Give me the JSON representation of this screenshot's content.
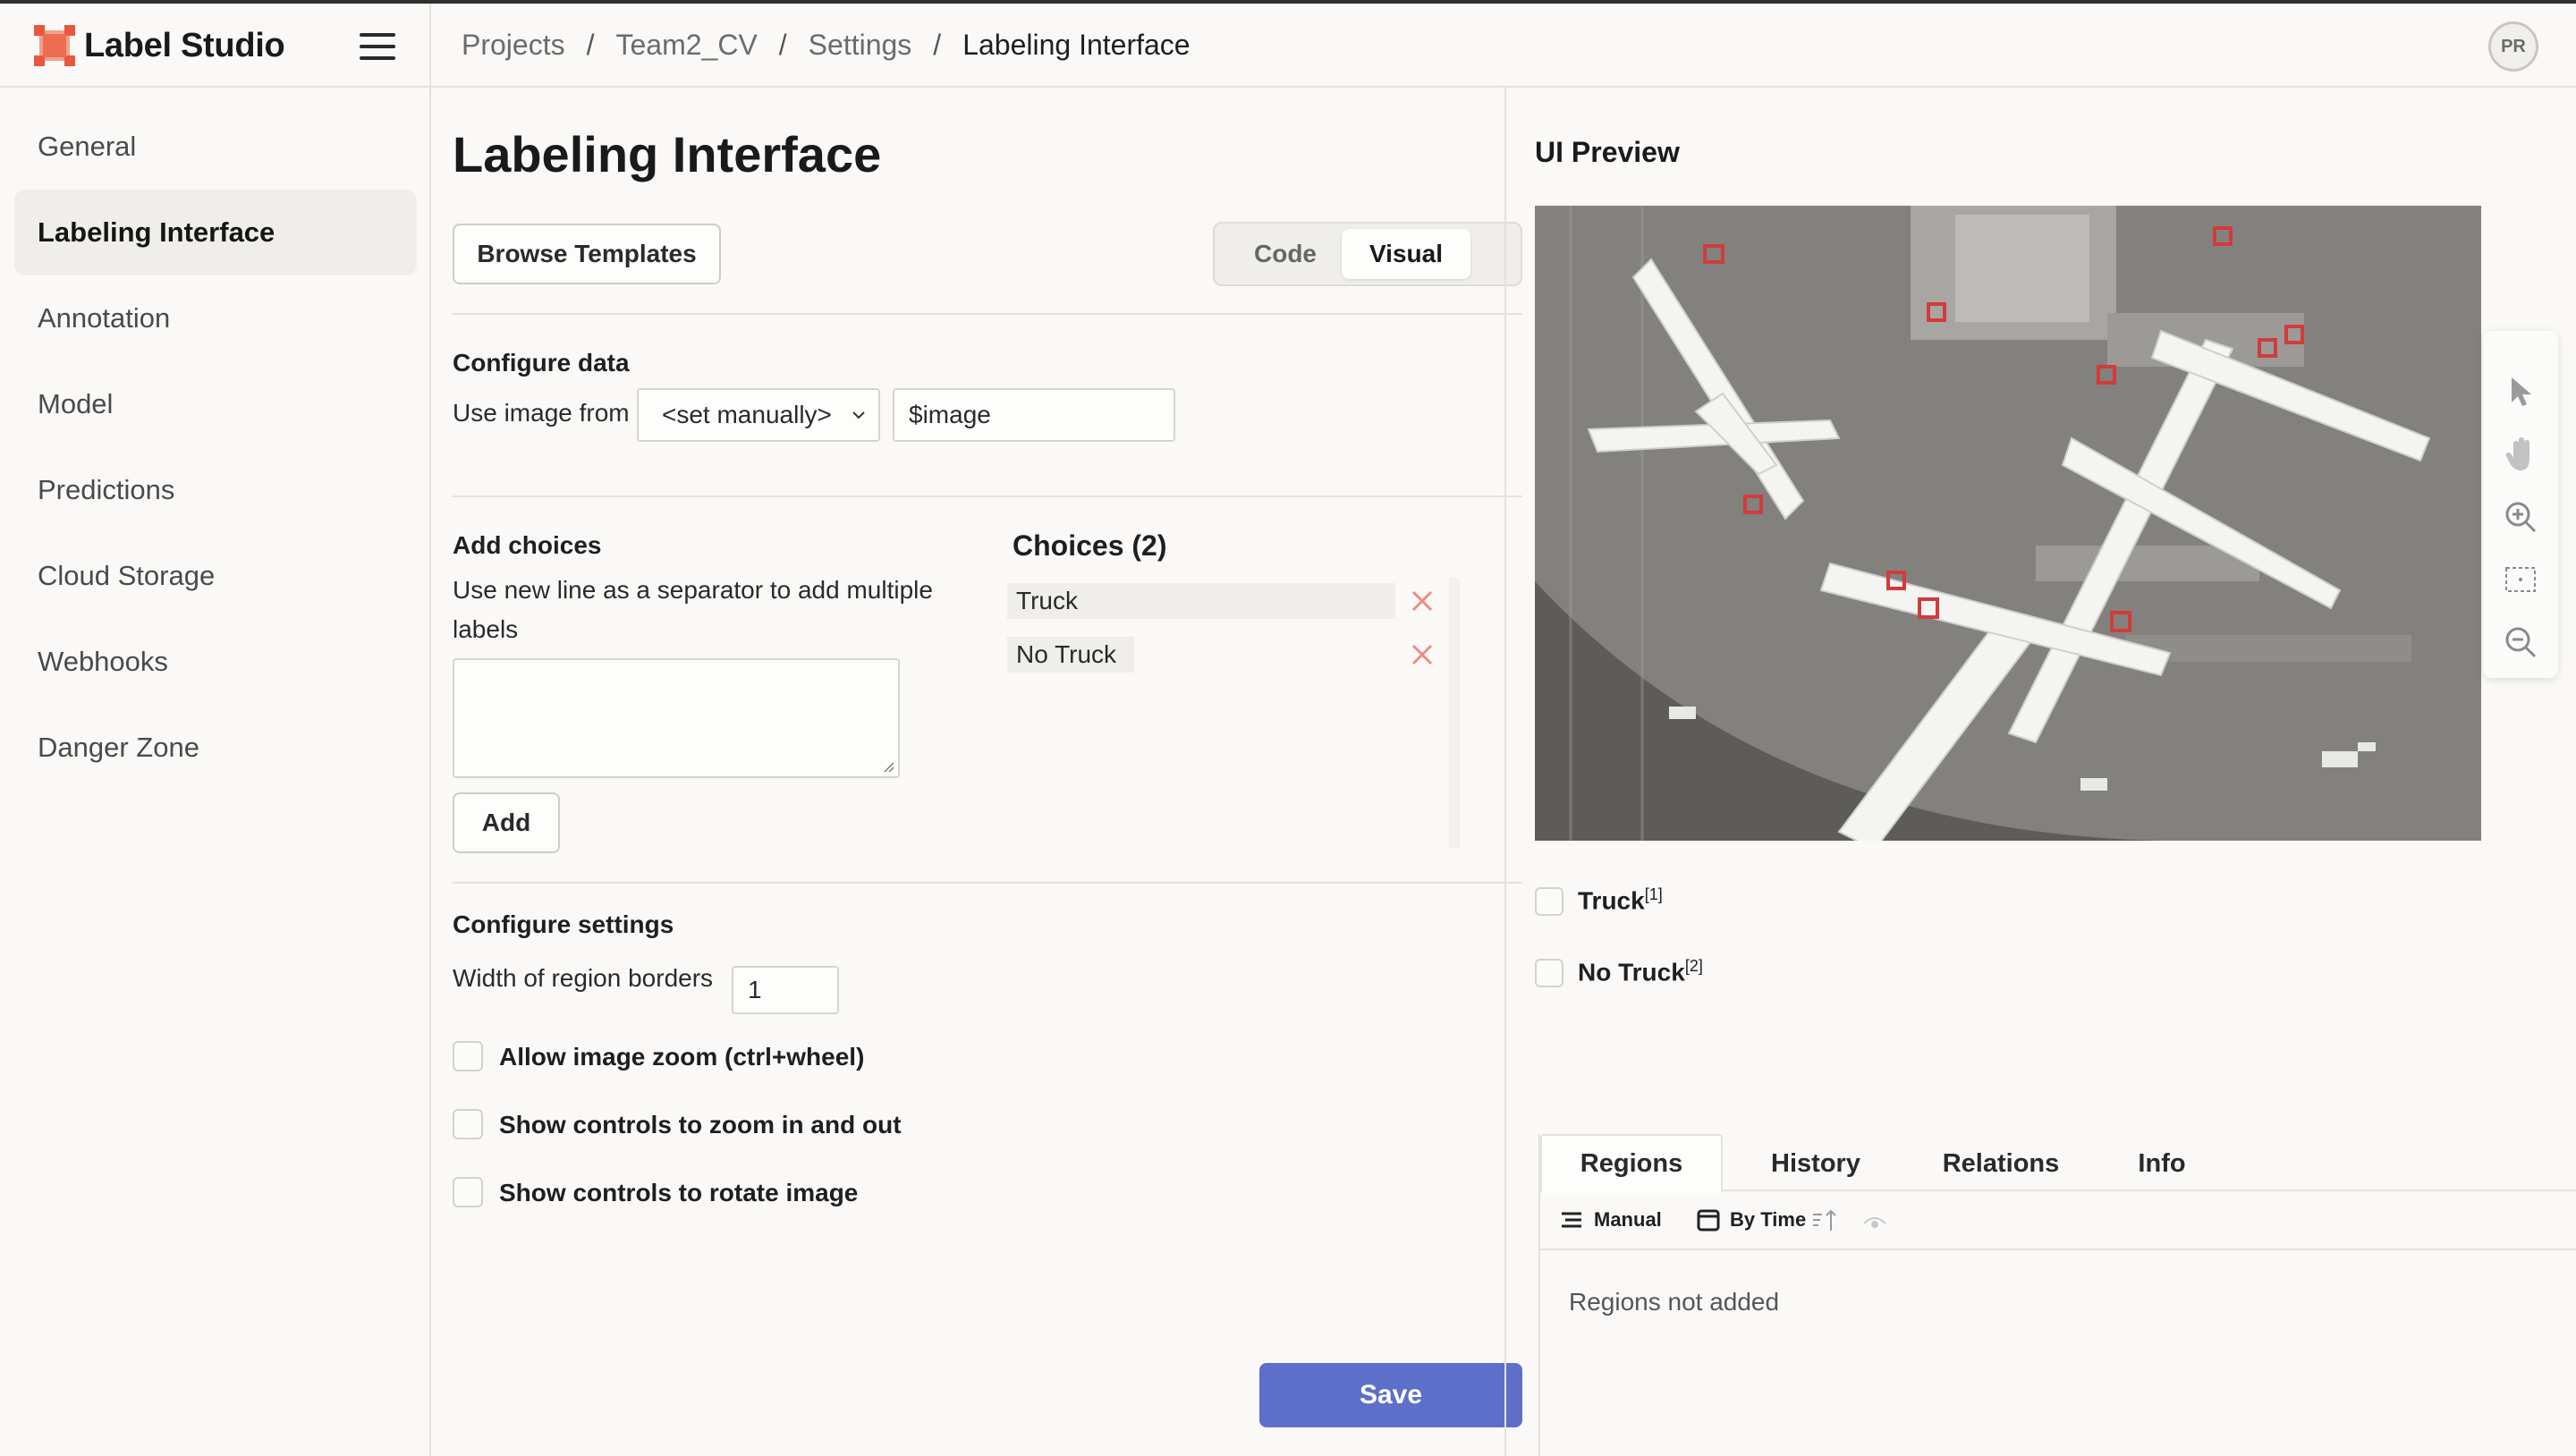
{
  "app": {
    "title": "Label Studio"
  },
  "breadcrumb": {
    "items": [
      "Projects",
      "Team2_CV",
      "Settings",
      "Labeling Interface"
    ],
    "separator": "/"
  },
  "user": {
    "initials": "PR"
  },
  "sidebar": {
    "items": [
      {
        "label": "General"
      },
      {
        "label": "Labeling Interface",
        "active": true
      },
      {
        "label": "Annotation"
      },
      {
        "label": "Model"
      },
      {
        "label": "Predictions"
      },
      {
        "label": "Cloud Storage"
      },
      {
        "label": "Webhooks"
      },
      {
        "label": "Danger Zone"
      }
    ]
  },
  "main": {
    "title": "Labeling Interface",
    "browse_templates": "Browse Templates",
    "mode_tabs": {
      "code": "Code",
      "visual": "Visual",
      "active": "Visual"
    },
    "configure_data": {
      "title": "Configure data",
      "use_image_label": "Use image from",
      "select_value": "<set manually>",
      "input_value": "$image"
    },
    "add_choices": {
      "title": "Add choices",
      "help": "Use new line as a separator to add multiple labels",
      "textarea_value": "",
      "add_label": "Add"
    },
    "choices": {
      "title": "Choices (2)",
      "items": [
        "Truck",
        "No Truck"
      ]
    },
    "configure_settings": {
      "title": "Configure settings",
      "border_width_label": "Width of region borders",
      "border_width_value": "1",
      "options": [
        {
          "label": "Allow image zoom (ctrl+wheel)",
          "checked": false
        },
        {
          "label": "Show controls to zoom in and out",
          "checked": false
        },
        {
          "label": "Show controls to rotate image",
          "checked": false
        }
      ]
    },
    "save_label": "Save"
  },
  "preview": {
    "title": "UI Preview",
    "choices": [
      {
        "label": "Truck",
        "hotkey": "[1]",
        "checked": false
      },
      {
        "label": "No Truck",
        "hotkey": "[2]",
        "checked": false
      }
    ],
    "tabs": [
      "Regions",
      "History",
      "Relations",
      "Info"
    ],
    "active_tab": "Regions",
    "sort": {
      "manual": "Manual",
      "by_time": "By Time"
    },
    "empty_text": "Regions not added"
  },
  "icons": {
    "toolbar": [
      "pointer-icon",
      "hand-icon",
      "zoom-in-icon",
      "fit-screen-icon",
      "zoom-out-icon"
    ]
  },
  "colors": {
    "accent": "#5e6fc9",
    "logo": "#e8583d",
    "remove": "#f08a80"
  }
}
